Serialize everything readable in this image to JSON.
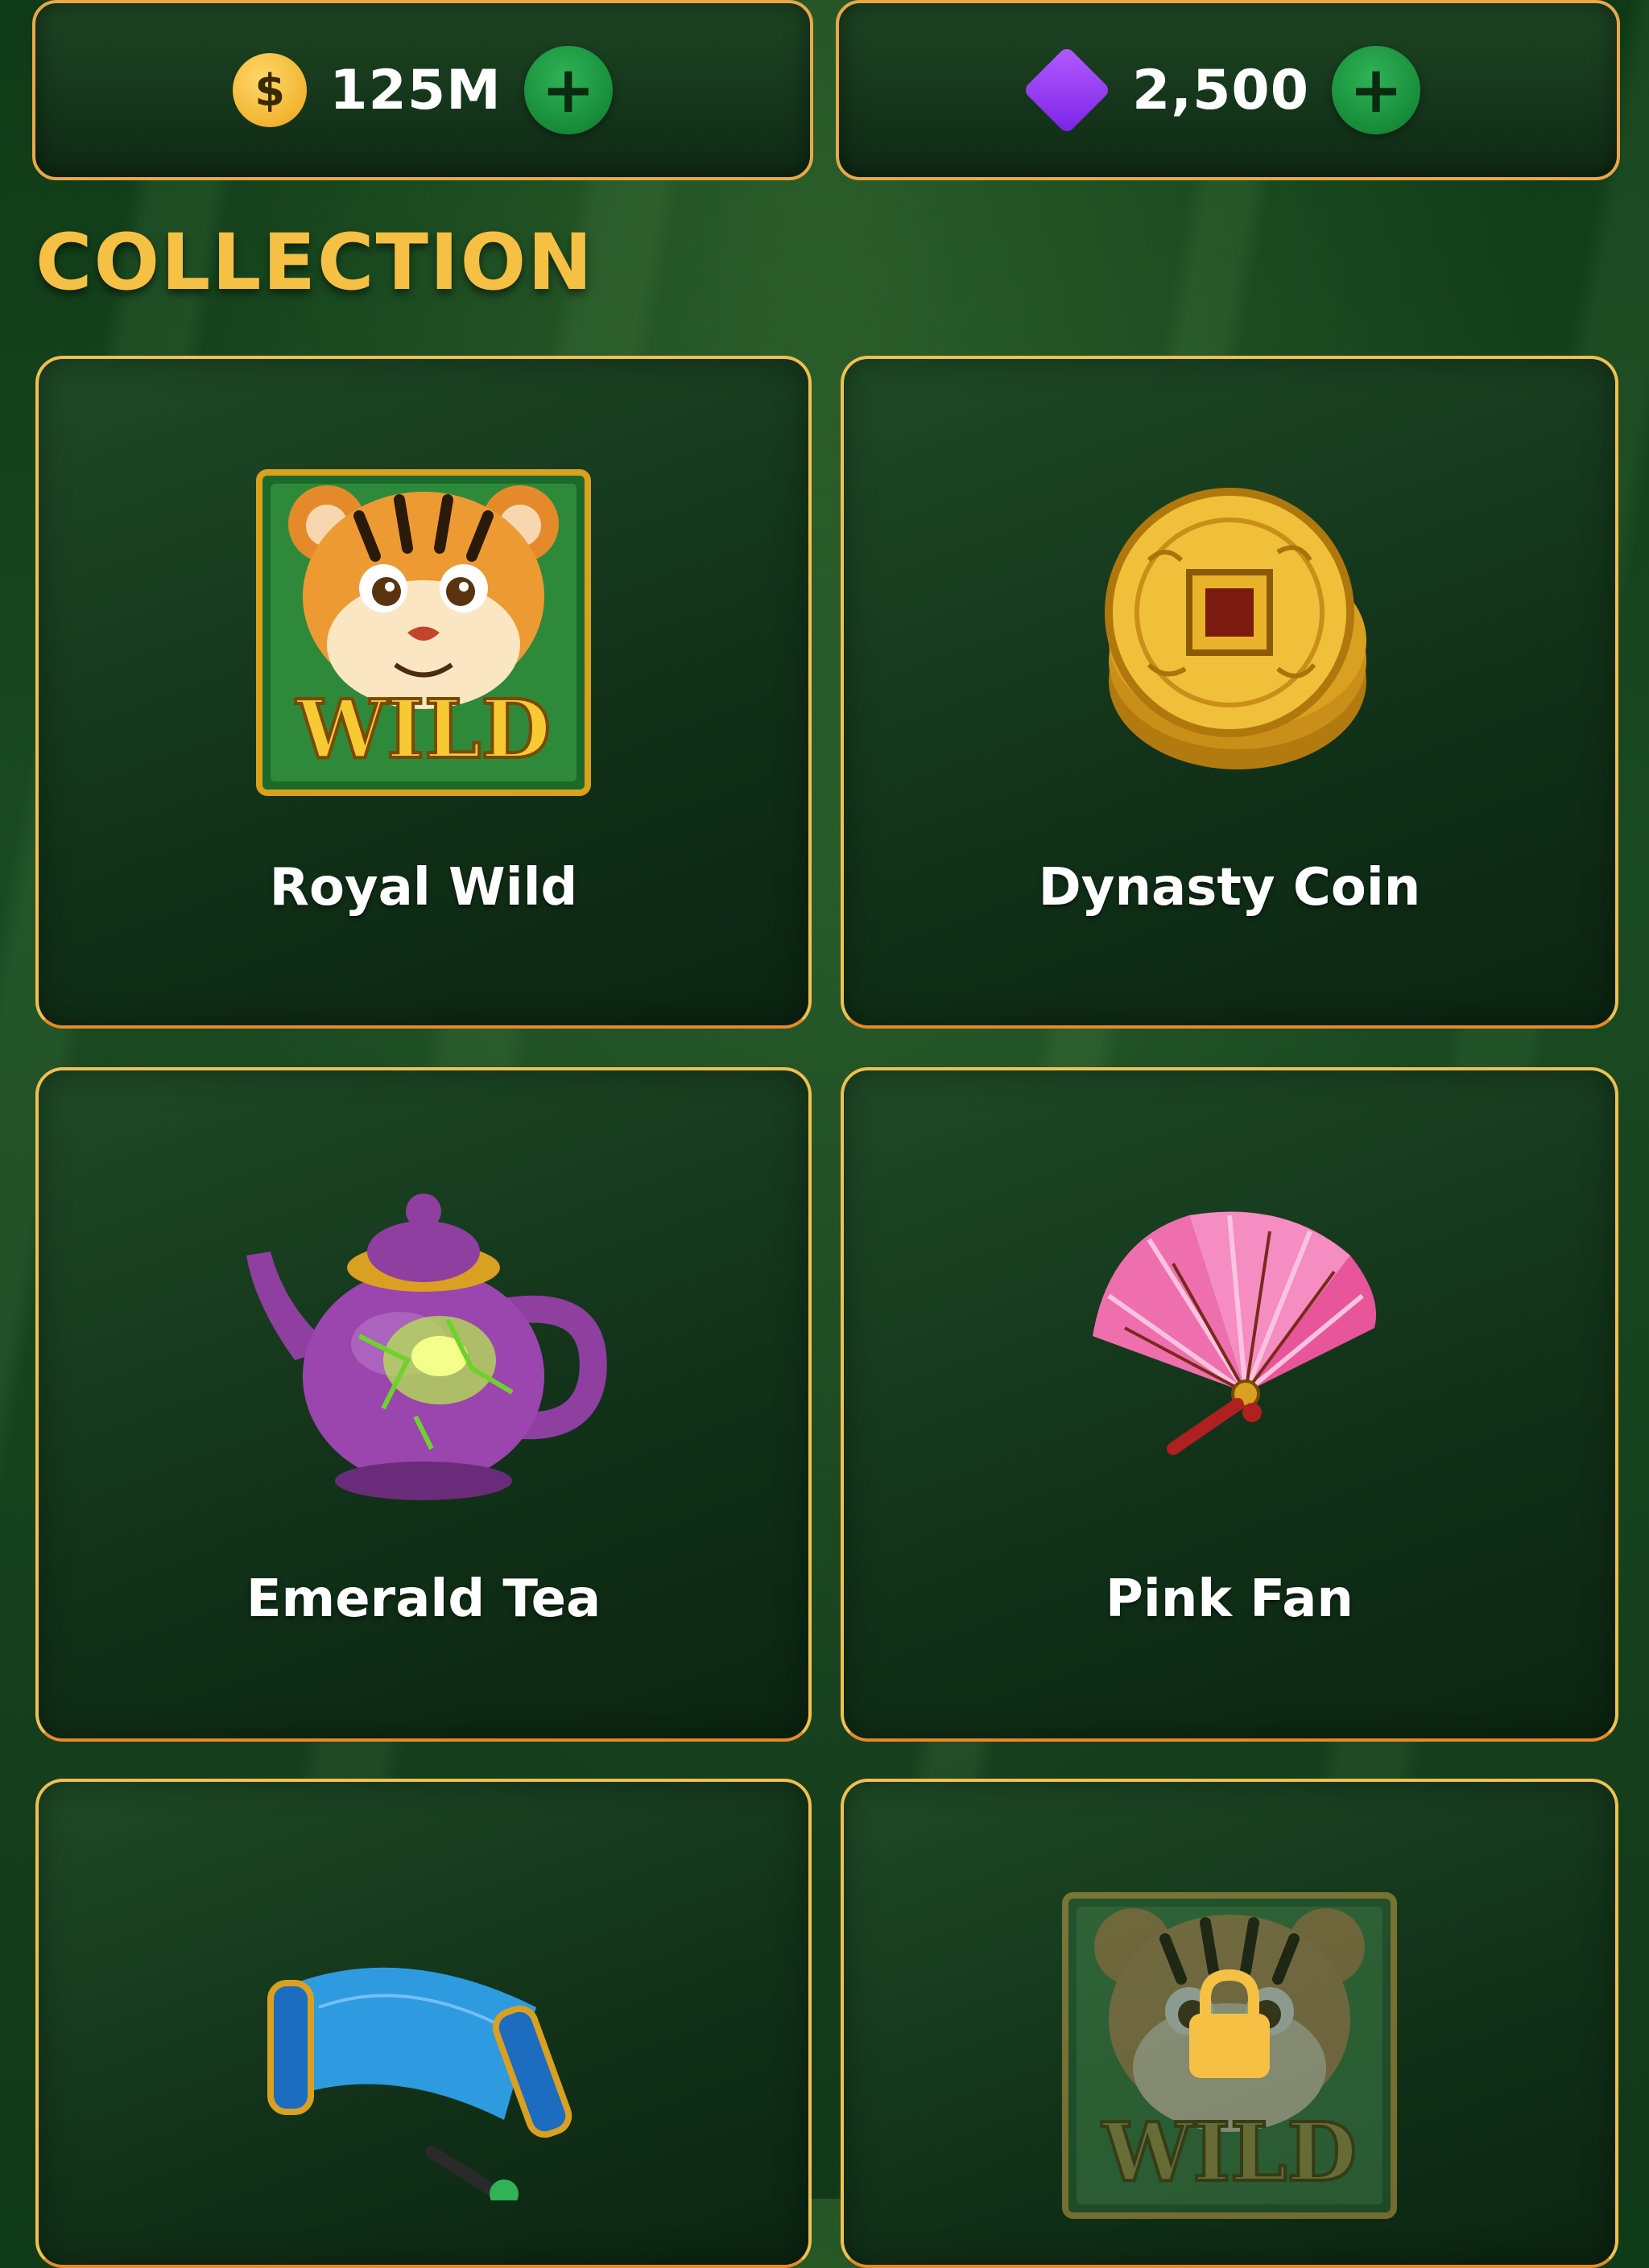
{
  "currency": {
    "coins": "125M",
    "gems": "2,500",
    "coin_symbol": "$"
  },
  "section_title": "COLLECTION",
  "items": [
    {
      "name": "Royal Wild",
      "icon": "tiger-wild-icon",
      "badge": "WILD",
      "locked": false
    },
    {
      "name": "Dynasty Coin",
      "icon": "dynasty-coin-icon",
      "locked": false
    },
    {
      "name": "Emerald Tea",
      "icon": "teapot-icon",
      "locked": false
    },
    {
      "name": "Pink Fan",
      "icon": "pink-fan-icon",
      "locked": false
    },
    {
      "name": "",
      "icon": "blue-scroll-icon",
      "locked": false
    },
    {
      "name": "",
      "icon": "tiger-wild-icon",
      "badge": "WILD",
      "locked": true
    }
  ],
  "colors": {
    "border_gold": "#f0c050",
    "title_gold": "#f5c044",
    "plus_green": "#178c3a",
    "gem_purple": "#8a2be2"
  }
}
